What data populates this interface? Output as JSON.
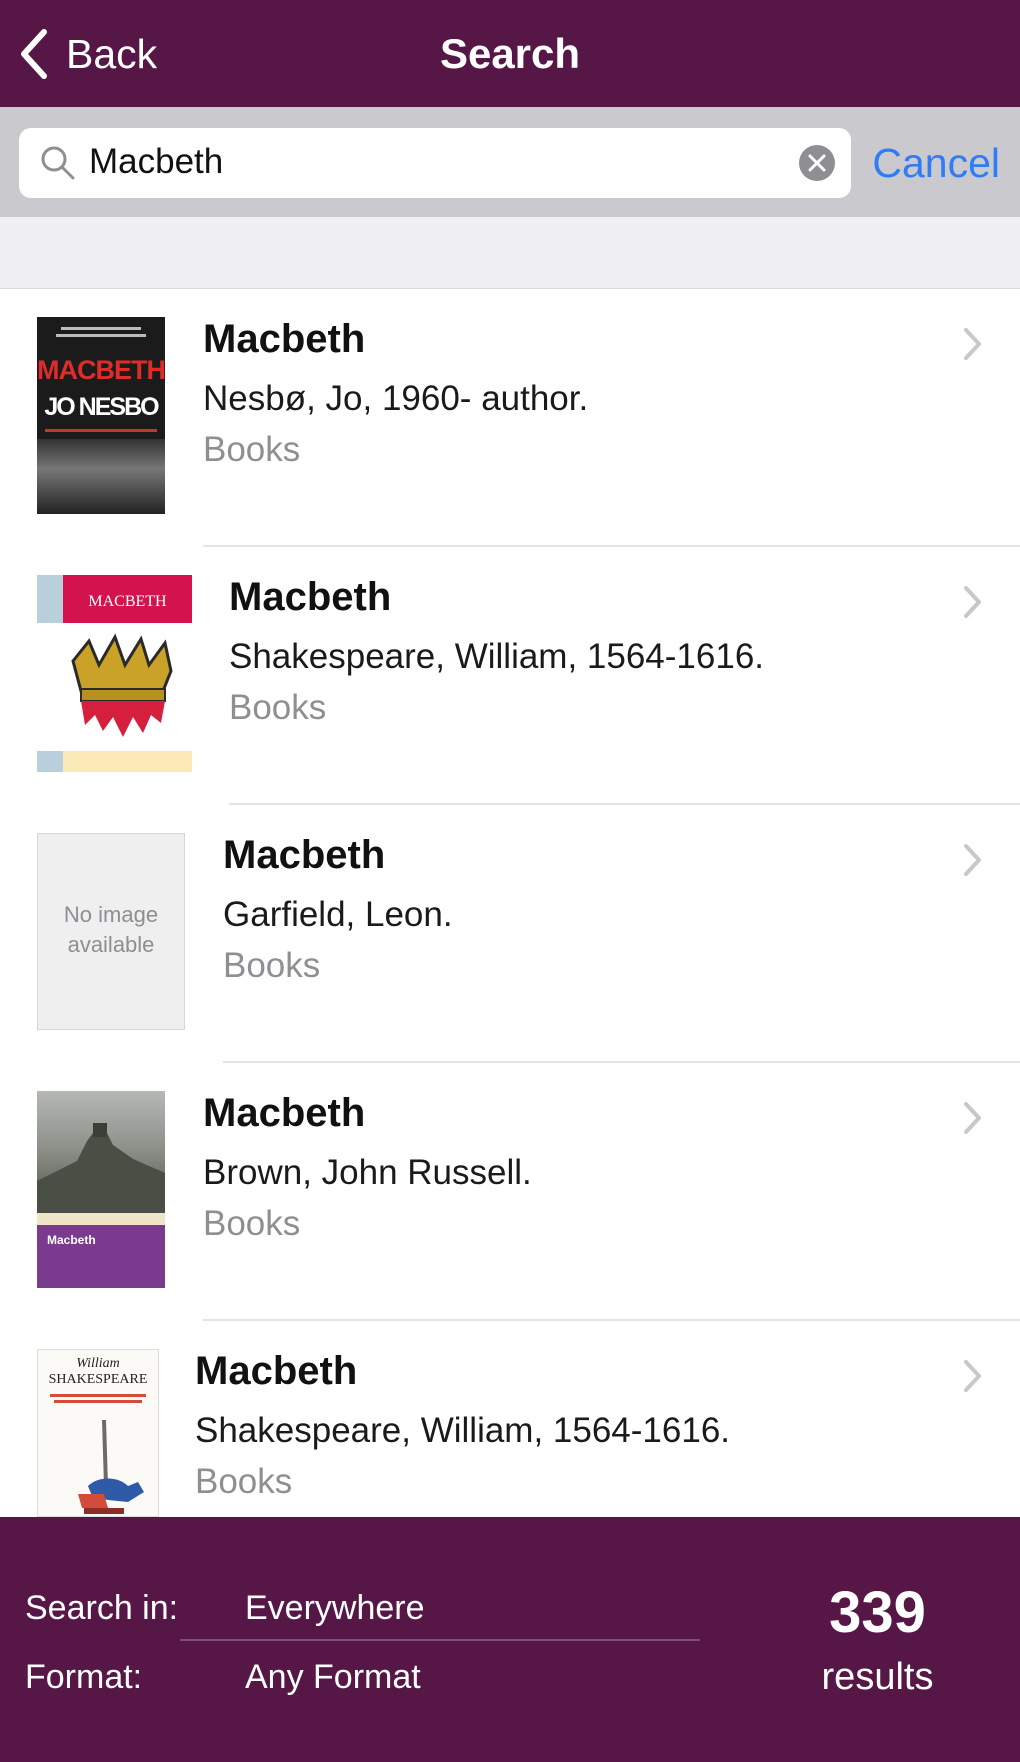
{
  "nav": {
    "back_label": "Back",
    "title": "Search"
  },
  "search": {
    "value": "Macbeth",
    "cancel_label": "Cancel"
  },
  "results": [
    {
      "title": "Macbeth",
      "author": "Nesbø, Jo, 1960- author.",
      "format": "Books",
      "cover": "macbeth-nesbo-cover",
      "cover_text": [
        "MACBETH",
        "JO NESBO"
      ]
    },
    {
      "title": "Macbeth",
      "author": "Shakespeare, William, 1564-1616.",
      "format": "Books",
      "cover": "oxford-school-shakespeare-cover",
      "cover_text": [
        "MACBETH"
      ]
    },
    {
      "title": "Macbeth",
      "author": "Garfield, Leon.",
      "format": "Books",
      "cover": "no-image-placeholder",
      "cover_text": [
        "No image",
        "available"
      ]
    },
    {
      "title": "Macbeth",
      "author": "Brown, John Russell.",
      "format": "Books",
      "cover": "shakespeare-handbooks-cover",
      "cover_text": [
        "Macbeth"
      ]
    },
    {
      "title": "Macbeth",
      "author": "Shakespeare, William, 1564-1616.",
      "format": "Books",
      "cover": "penguin-shakespeare-cover",
      "cover_text": [
        "William",
        "SHAKESPEARE"
      ]
    }
  ],
  "footer": {
    "search_in_label": "Search in:",
    "search_in_value": "Everywhere",
    "format_label": "Format:",
    "format_value": "Any Format",
    "count": "339",
    "count_label": "results"
  },
  "colors": {
    "brand": "#561747",
    "link": "#2f7cf6",
    "secondary_text": "#8e8e93"
  }
}
